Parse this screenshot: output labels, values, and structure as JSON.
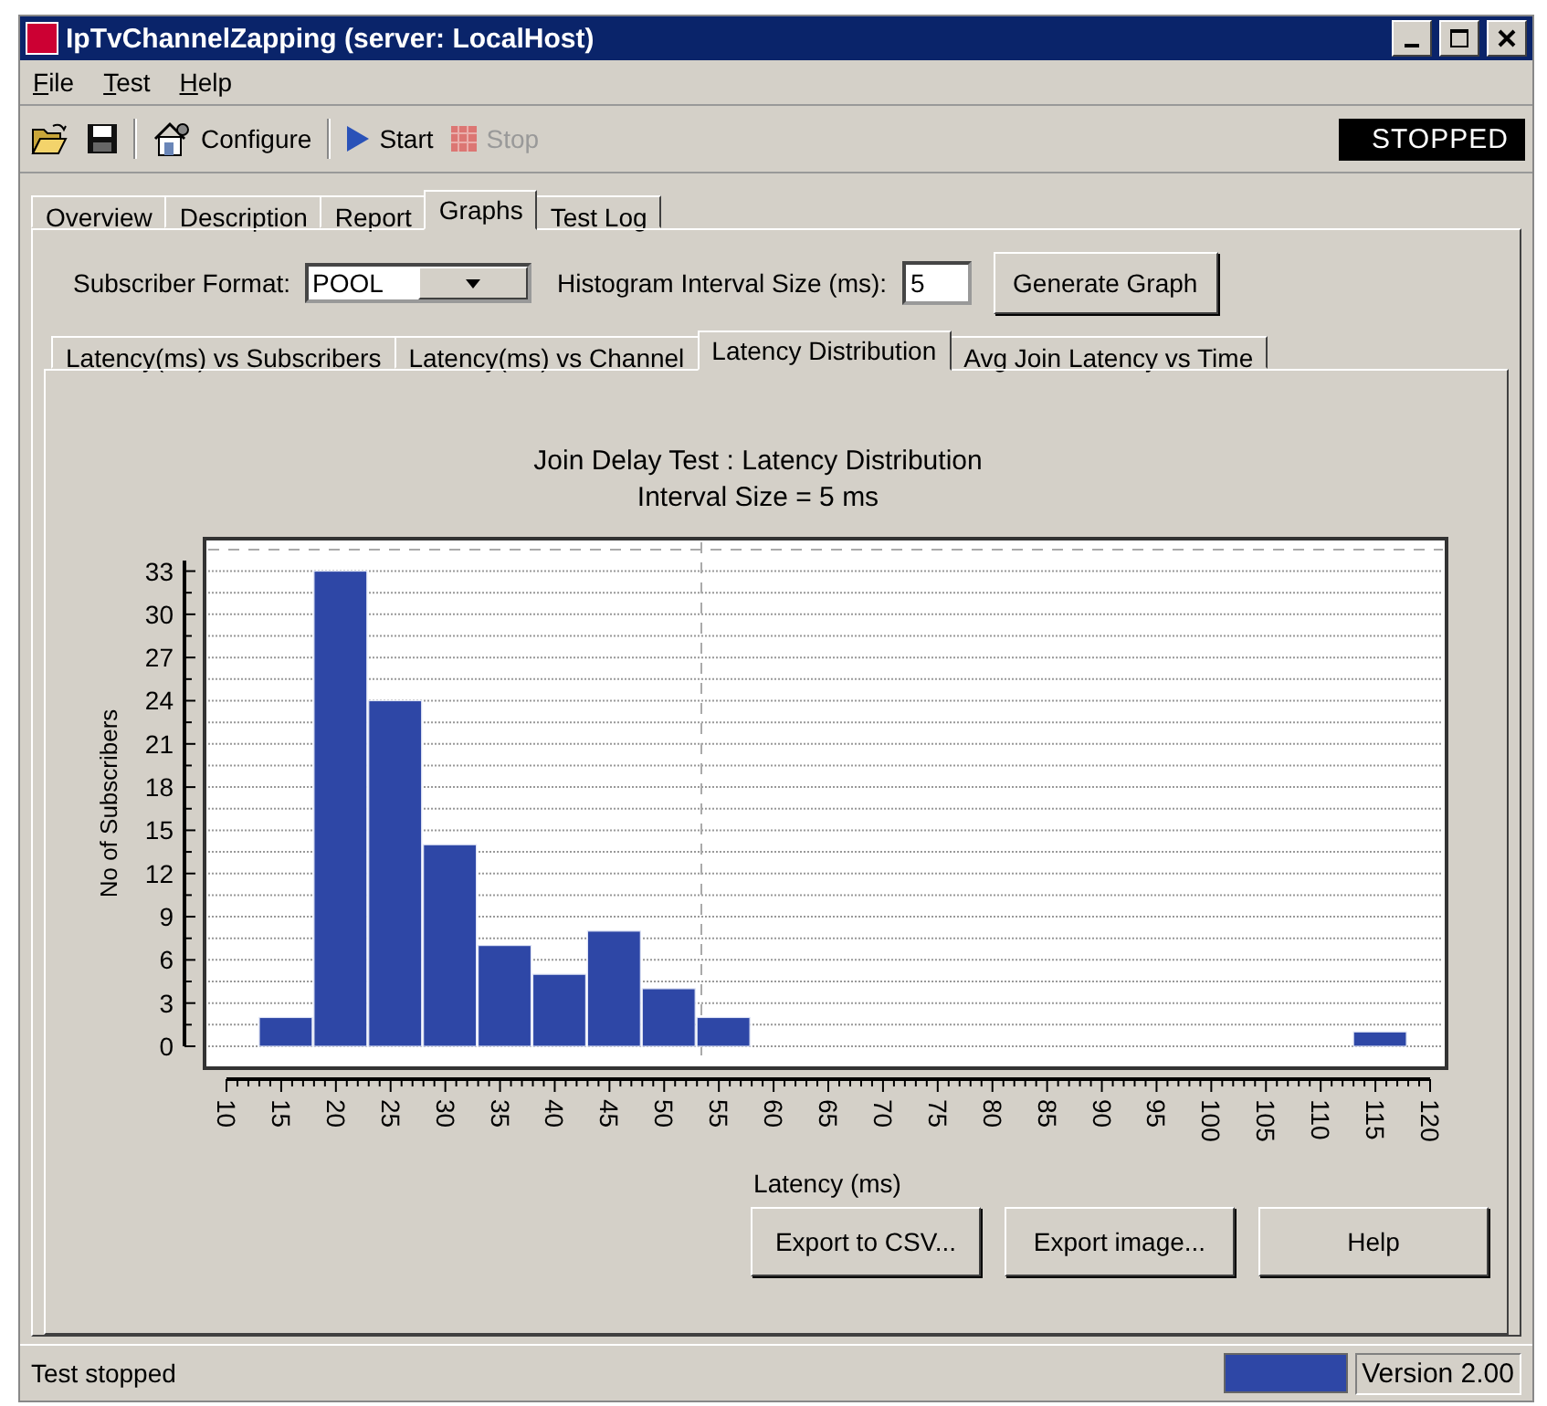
{
  "window": {
    "title": "IpTvChannelZapping (server: LocalHost)"
  },
  "menu": [
    {
      "label": "File"
    },
    {
      "label": "Test"
    },
    {
      "label": "Help"
    }
  ],
  "toolbar": {
    "items": [
      {
        "kind": "open"
      },
      {
        "kind": "save"
      },
      {
        "kind": "configure",
        "label": "Configure"
      },
      {
        "kind": "start",
        "label": "Start",
        "disabled": false
      },
      {
        "kind": "stop",
        "label": "Stop",
        "disabled": true
      }
    ],
    "status": "STOPPED"
  },
  "tabs": [
    {
      "label": "Overview",
      "selected": false
    },
    {
      "label": "Description",
      "selected": false
    },
    {
      "label": "Report",
      "selected": false
    },
    {
      "label": "Graphs",
      "selected": true
    },
    {
      "label": "Test Log",
      "selected": false
    }
  ],
  "controls": {
    "subscriber_format": {
      "label": "Subscriber Format:",
      "value": "POOL"
    },
    "interval": {
      "label": "Histogram Interval Size (ms):",
      "value": "5"
    },
    "button": "Generate Graph"
  },
  "graph_tabs": [
    {
      "label": "Latency(ms) vs Subscribers",
      "selected": false
    },
    {
      "label": "Latency(ms) vs Channel",
      "selected": false
    },
    {
      "label": "Latency Distribution",
      "selected": true
    },
    {
      "label": "Avg Join Latency vs Time",
      "selected": false
    }
  ],
  "chart": {
    "subtitle": "Interval Size = 5 ms",
    "chart_data": {
      "type": "bar",
      "title": "Join Delay Test : Latency Distribution",
      "xlabel": "Latency (ms)",
      "ylabel": "No of Subscribers",
      "x": [
        15.5,
        20.5,
        25.5,
        30.5,
        35.5,
        40.5,
        45.5,
        50.5,
        55.5,
        115.5
      ],
      "series": [
        {
          "color": "#2e47a6",
          "values": [
            2,
            33,
            24,
            14,
            7,
            5,
            8,
            4,
            2,
            1
          ]
        }
      ],
      "grid": true,
      "ref_lines": [
        {
          "axis": "x",
          "value": 53.4
        },
        {
          "axis": "y",
          "value": 34.5
        }
      ],
      "xlim": [
        10,
        120
      ],
      "ylim": [
        0,
        35
      ],
      "xticks": [
        10,
        15,
        20,
        25,
        30,
        35,
        40,
        45,
        50,
        55,
        60,
        65,
        70,
        75,
        80,
        85,
        90,
        95,
        100,
        105,
        110,
        115,
        120
      ],
      "yticks": [
        0,
        3,
        6,
        9,
        12,
        15,
        18,
        21,
        24,
        27,
        30,
        33
      ]
    }
  },
  "buttons": [
    "Export to CSV...",
    "Export image...",
    "Help"
  ],
  "status_bar": {
    "text": "Test stopped",
    "version": "Version 2.00"
  }
}
